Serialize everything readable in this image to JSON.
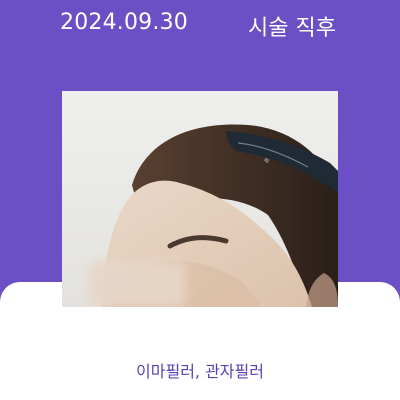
{
  "header": {
    "date": "2024.09.30",
    "status": "시술 직후"
  },
  "photo": {
    "icon": "before-after-photo",
    "description_icon": "headband-icon"
  },
  "caption": {
    "text": "이마필러, 관자필러"
  },
  "colors": {
    "background": "#6b4fc4",
    "card": "#ffffff",
    "caption": "#5a42b6",
    "header_text": "#ffffff"
  }
}
